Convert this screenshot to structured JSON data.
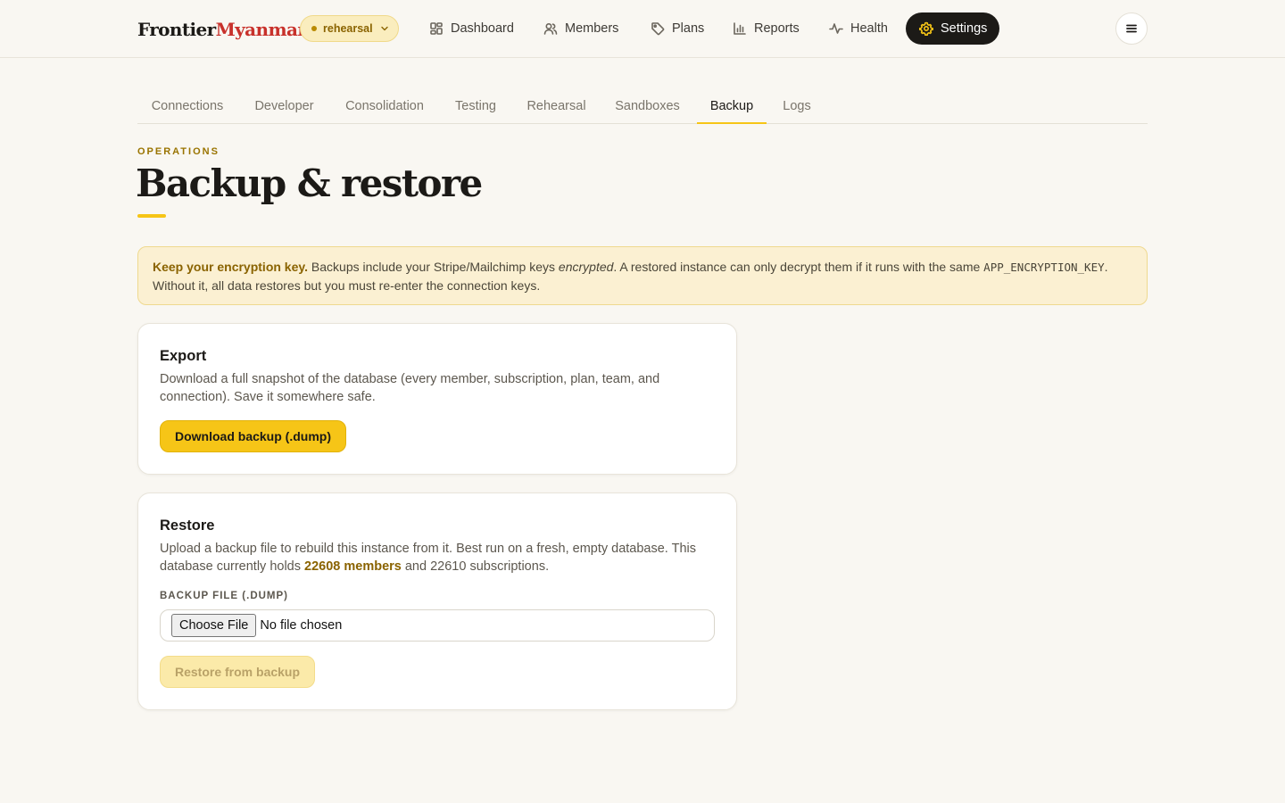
{
  "brand": {
    "part1": "Frontier",
    "part2": "Myanmar"
  },
  "environment": {
    "label": "rehearsal"
  },
  "nav": {
    "items": [
      {
        "label": "Dashboard",
        "icon": "grid-icon"
      },
      {
        "label": "Members",
        "icon": "users-icon"
      },
      {
        "label": "Plans",
        "icon": "tag-icon"
      },
      {
        "label": "Reports",
        "icon": "bar-chart-icon"
      },
      {
        "label": "Health",
        "icon": "activity-icon"
      },
      {
        "label": "Settings",
        "icon": "gear-icon",
        "active": true
      }
    ]
  },
  "subtabs": [
    {
      "label": "Connections"
    },
    {
      "label": "Developer"
    },
    {
      "label": "Consolidation"
    },
    {
      "label": "Testing"
    },
    {
      "label": "Rehearsal"
    },
    {
      "label": "Sandboxes"
    },
    {
      "label": "Backup",
      "active": true
    },
    {
      "label": "Logs"
    }
  ],
  "header": {
    "eyebrow": "OPERATIONS",
    "title": "Backup & restore"
  },
  "notice": {
    "strong": "Keep your encryption key.",
    "text1": " Backups include your Stripe/Mailchimp keys ",
    "em": "encrypted",
    "text2": ". A restored instance can only decrypt them if it runs with the same ",
    "code": "APP_ENCRYPTION_KEY",
    "text3": ". Without it, all data restores but you must re-enter the connection keys."
  },
  "export": {
    "title": "Export",
    "description": "Download a full snapshot of the database (every member, subscription, plan, team, and connection). Save it somewhere safe.",
    "button": "Download backup (.dump)"
  },
  "restore": {
    "title": "Restore",
    "text1": "Upload a backup file to rebuild this instance from it. Best run on a fresh, empty database. This database currently holds ",
    "members": "22608 members",
    "text2": " and 22610 subscriptions.",
    "field_label": "BACKUP FILE (.DUMP)",
    "file_button": "Choose File",
    "file_status": "No file chosen",
    "button": "Restore from backup"
  },
  "colors": {
    "accent": "#f6c517",
    "brand_red": "#c8312b",
    "notice_bg": "#fbf0d2",
    "highlight": "#8a6300"
  }
}
